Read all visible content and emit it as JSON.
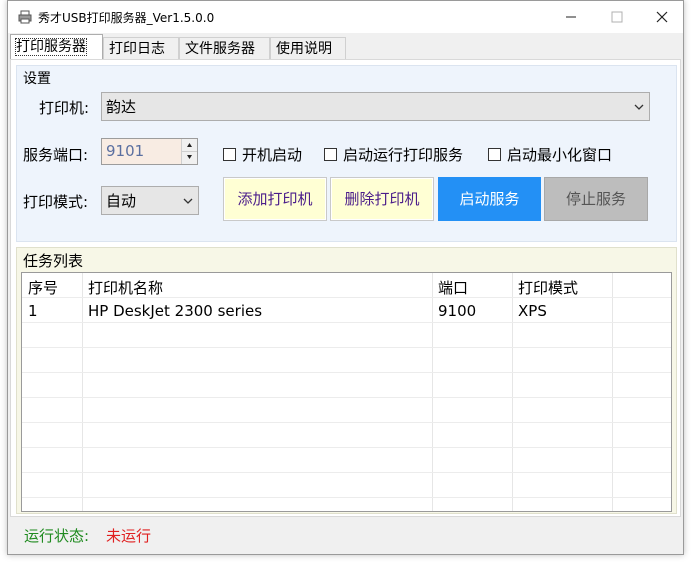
{
  "window": {
    "title": "秀才USB打印服务器_Ver1.5.0.0"
  },
  "tabs": [
    {
      "label": "打印服务器"
    },
    {
      "label": "打印日志"
    },
    {
      "label": "文件服务器"
    },
    {
      "label": "使用说明"
    }
  ],
  "settings": {
    "group_title": "设置",
    "printer_label": "打印机:",
    "printer_value": "韵达",
    "port_label": "服务端口:",
    "port_value": "9101",
    "autostart_label": "开机启动",
    "autostart_checked": false,
    "run_service_label": "启动运行打印服务",
    "run_service_checked": false,
    "minimize_label": "启动最小化窗口",
    "minimize_checked": false,
    "mode_label": "打印模式:",
    "mode_value": "自动",
    "add_button": "添加打印机",
    "delete_button": "删除打印机",
    "start_button": "启动服务",
    "stop_button": "停止服务"
  },
  "tasks": {
    "group_title": "任务列表",
    "columns": [
      "序号",
      "打印机名称",
      "端口",
      "打印模式"
    ],
    "rows": [
      [
        "1",
        "HP DeskJet 2300 series",
        "9100",
        "XPS"
      ]
    ]
  },
  "status": {
    "label": "运行状态:",
    "value": "未运行",
    "label_color": "#1e8a1e",
    "value_color": "#e02020"
  },
  "colors": {
    "start_button": "#2390f5",
    "add_button_bg": "#ffffd4",
    "stop_button_bg": "#bdbdbd"
  }
}
